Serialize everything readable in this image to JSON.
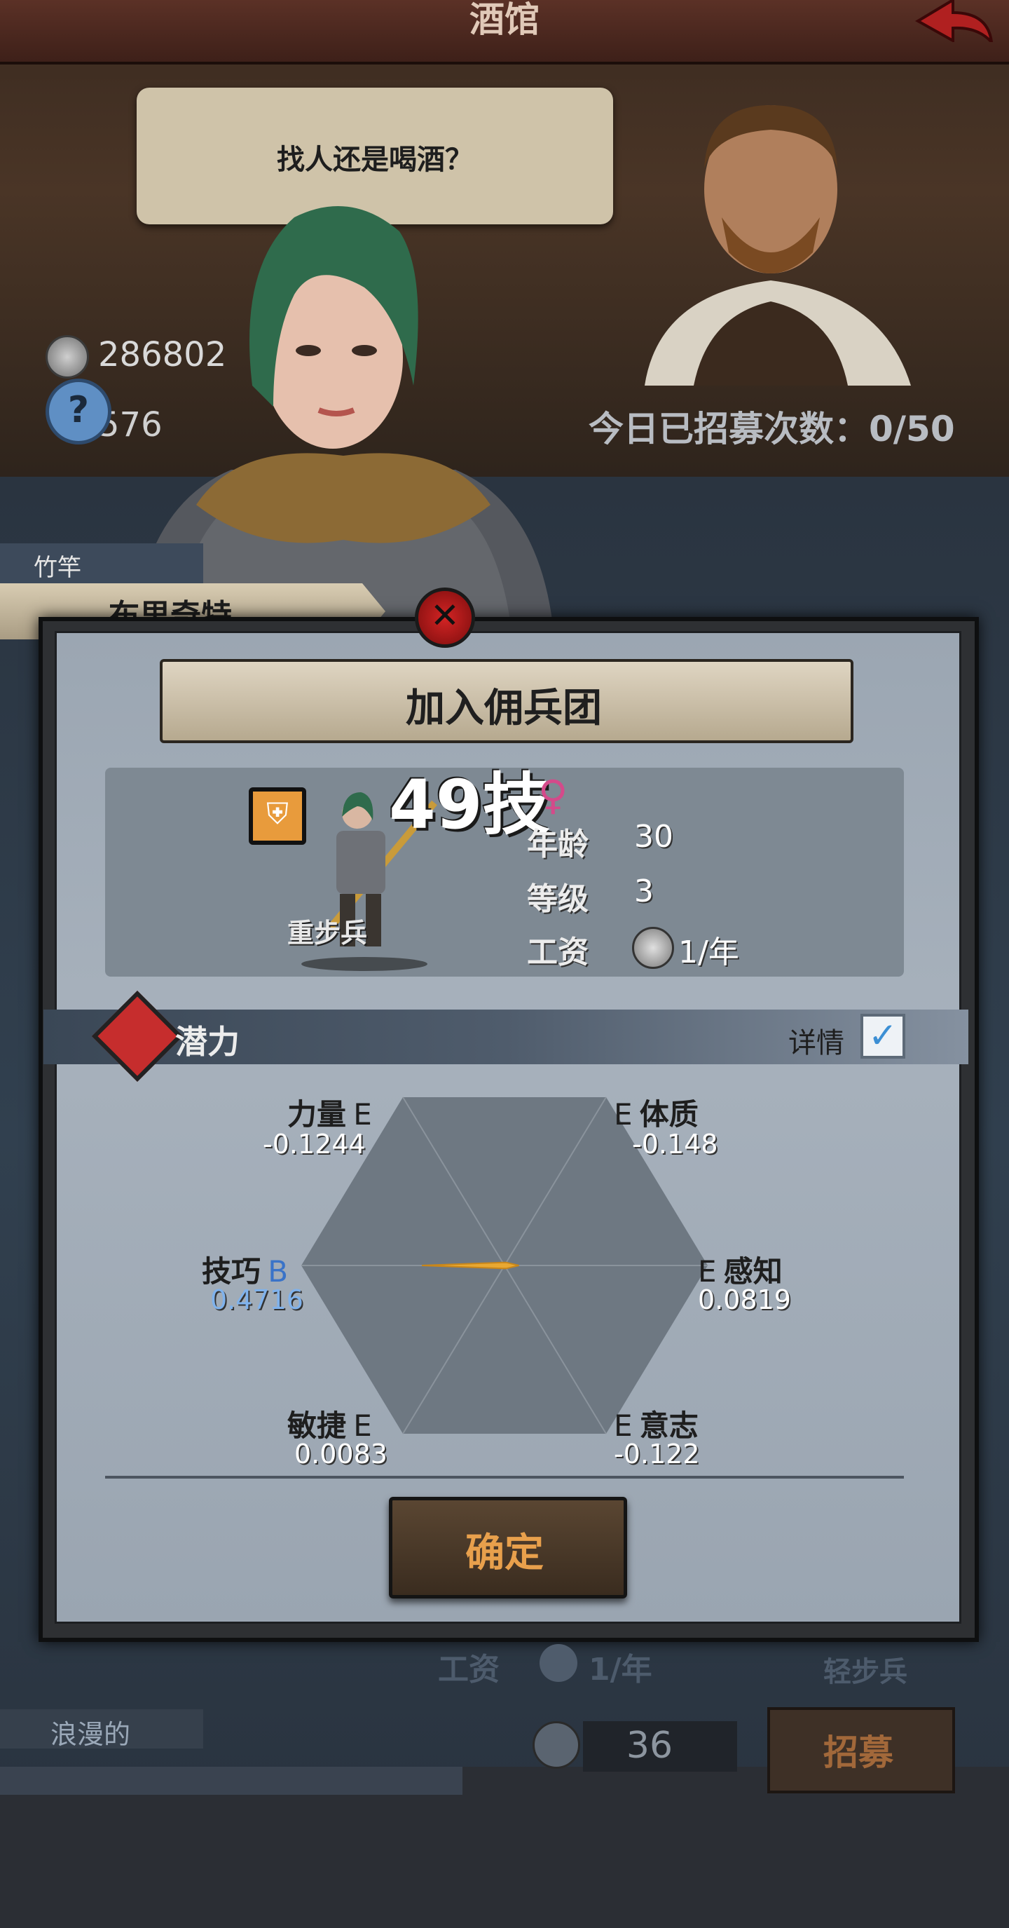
{
  "header": {
    "title": "酒馆"
  },
  "speech": {
    "text": "找人还是喝酒？"
  },
  "currency": {
    "money": "286802",
    "second": "576"
  },
  "recruit": {
    "count_label": "今日已招募次数：0/50"
  },
  "mercenary": {
    "nickname": "竹竿",
    "name": "布里奇特",
    "class_name": "重步兵",
    "rating": "49技",
    "gender": "female",
    "age_label": "年龄",
    "age": "30",
    "level_label": "等级",
    "level": "3",
    "salary_label": "工资",
    "salary": "1/年"
  },
  "dialog": {
    "title": "加入佣兵团",
    "confirm_label": "确定"
  },
  "potential": {
    "label": "潜力",
    "detail_label": "详情",
    "detail_checked": true,
    "attributes": [
      {
        "name": "力量",
        "grade": "E",
        "value": "-0.1244"
      },
      {
        "name": "体质",
        "grade": "E",
        "value": "-0.148"
      },
      {
        "name": "技巧",
        "grade": "B",
        "value": "0.4716"
      },
      {
        "name": "感知",
        "grade": "E",
        "value": "0.0819"
      },
      {
        "name": "敏捷",
        "grade": "E",
        "value": "0.0083"
      },
      {
        "name": "意志",
        "grade": "E",
        "value": "-0.122"
      }
    ]
  },
  "background_list": {
    "salary_label": "工资",
    "salary": "1/年",
    "class_name": "轻步兵",
    "nickname": "浪漫的",
    "cost": "36",
    "recruit_label": "招募"
  },
  "colors": {
    "accent": "#e8a04c",
    "highlight_grade": "#3a73c8",
    "gender": "#d44a8a",
    "radar_fill": "#e8a832"
  }
}
